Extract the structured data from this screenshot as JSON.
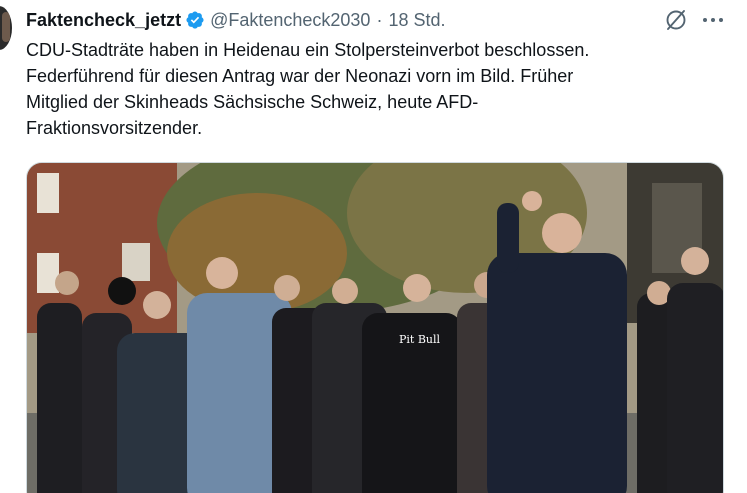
{
  "tweet": {
    "author": {
      "display_name": "Faktencheck_jetzt",
      "handle": "@Faktencheck2030",
      "verified": true
    },
    "separator": "·",
    "timestamp": "18 Std.",
    "text_lines": [
      "CDU-Stadträte haben in Heidenau ein Stolpersteinverbot beschlossen.",
      "Federführend für diesen Antrag war der Neonazi vorn im Bild. Früher",
      "Mitglied der Skinheads Sächsische Schweiz, heute AFD-",
      "Fraktionsvorsitzender."
    ],
    "photo_shirt_text": "Pit Bull"
  },
  "colors": {
    "text_primary": "#0f1419",
    "text_secondary": "#536471",
    "verified_blue": "#1d9bf0",
    "border": "#cfd9de"
  },
  "icons": {
    "verified": "verified-badge-icon",
    "grok": "grok-icon",
    "more": "more-icon"
  }
}
